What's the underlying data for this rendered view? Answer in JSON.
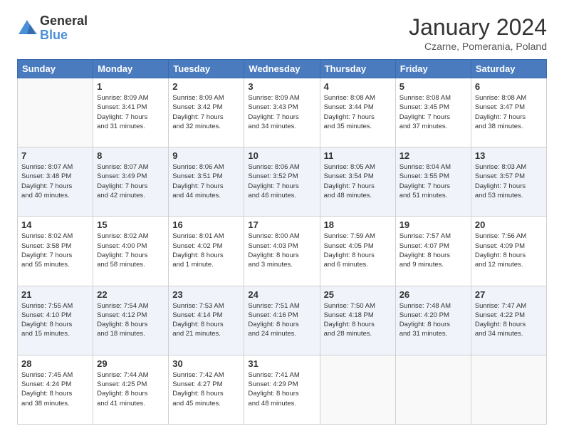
{
  "header": {
    "logo_general": "General",
    "logo_blue": "Blue",
    "month_title": "January 2024",
    "subtitle": "Czarne, Pomerania, Poland"
  },
  "weekdays": [
    "Sunday",
    "Monday",
    "Tuesday",
    "Wednesday",
    "Thursday",
    "Friday",
    "Saturday"
  ],
  "weeks": [
    [
      {
        "day": "",
        "info": ""
      },
      {
        "day": "1",
        "info": "Sunrise: 8:09 AM\nSunset: 3:41 PM\nDaylight: 7 hours\nand 31 minutes."
      },
      {
        "day": "2",
        "info": "Sunrise: 8:09 AM\nSunset: 3:42 PM\nDaylight: 7 hours\nand 32 minutes."
      },
      {
        "day": "3",
        "info": "Sunrise: 8:09 AM\nSunset: 3:43 PM\nDaylight: 7 hours\nand 34 minutes."
      },
      {
        "day": "4",
        "info": "Sunrise: 8:08 AM\nSunset: 3:44 PM\nDaylight: 7 hours\nand 35 minutes."
      },
      {
        "day": "5",
        "info": "Sunrise: 8:08 AM\nSunset: 3:45 PM\nDaylight: 7 hours\nand 37 minutes."
      },
      {
        "day": "6",
        "info": "Sunrise: 8:08 AM\nSunset: 3:47 PM\nDaylight: 7 hours\nand 38 minutes."
      }
    ],
    [
      {
        "day": "7",
        "info": "Sunrise: 8:07 AM\nSunset: 3:48 PM\nDaylight: 7 hours\nand 40 minutes."
      },
      {
        "day": "8",
        "info": "Sunrise: 8:07 AM\nSunset: 3:49 PM\nDaylight: 7 hours\nand 42 minutes."
      },
      {
        "day": "9",
        "info": "Sunrise: 8:06 AM\nSunset: 3:51 PM\nDaylight: 7 hours\nand 44 minutes."
      },
      {
        "day": "10",
        "info": "Sunrise: 8:06 AM\nSunset: 3:52 PM\nDaylight: 7 hours\nand 46 minutes."
      },
      {
        "day": "11",
        "info": "Sunrise: 8:05 AM\nSunset: 3:54 PM\nDaylight: 7 hours\nand 48 minutes."
      },
      {
        "day": "12",
        "info": "Sunrise: 8:04 AM\nSunset: 3:55 PM\nDaylight: 7 hours\nand 51 minutes."
      },
      {
        "day": "13",
        "info": "Sunrise: 8:03 AM\nSunset: 3:57 PM\nDaylight: 7 hours\nand 53 minutes."
      }
    ],
    [
      {
        "day": "14",
        "info": "Sunrise: 8:02 AM\nSunset: 3:58 PM\nDaylight: 7 hours\nand 55 minutes."
      },
      {
        "day": "15",
        "info": "Sunrise: 8:02 AM\nSunset: 4:00 PM\nDaylight: 7 hours\nand 58 minutes."
      },
      {
        "day": "16",
        "info": "Sunrise: 8:01 AM\nSunset: 4:02 PM\nDaylight: 8 hours\nand 1 minute."
      },
      {
        "day": "17",
        "info": "Sunrise: 8:00 AM\nSunset: 4:03 PM\nDaylight: 8 hours\nand 3 minutes."
      },
      {
        "day": "18",
        "info": "Sunrise: 7:59 AM\nSunset: 4:05 PM\nDaylight: 8 hours\nand 6 minutes."
      },
      {
        "day": "19",
        "info": "Sunrise: 7:57 AM\nSunset: 4:07 PM\nDaylight: 8 hours\nand 9 minutes."
      },
      {
        "day": "20",
        "info": "Sunrise: 7:56 AM\nSunset: 4:09 PM\nDaylight: 8 hours\nand 12 minutes."
      }
    ],
    [
      {
        "day": "21",
        "info": "Sunrise: 7:55 AM\nSunset: 4:10 PM\nDaylight: 8 hours\nand 15 minutes."
      },
      {
        "day": "22",
        "info": "Sunrise: 7:54 AM\nSunset: 4:12 PM\nDaylight: 8 hours\nand 18 minutes."
      },
      {
        "day": "23",
        "info": "Sunrise: 7:53 AM\nSunset: 4:14 PM\nDaylight: 8 hours\nand 21 minutes."
      },
      {
        "day": "24",
        "info": "Sunrise: 7:51 AM\nSunset: 4:16 PM\nDaylight: 8 hours\nand 24 minutes."
      },
      {
        "day": "25",
        "info": "Sunrise: 7:50 AM\nSunset: 4:18 PM\nDaylight: 8 hours\nand 28 minutes."
      },
      {
        "day": "26",
        "info": "Sunrise: 7:48 AM\nSunset: 4:20 PM\nDaylight: 8 hours\nand 31 minutes."
      },
      {
        "day": "27",
        "info": "Sunrise: 7:47 AM\nSunset: 4:22 PM\nDaylight: 8 hours\nand 34 minutes."
      }
    ],
    [
      {
        "day": "28",
        "info": "Sunrise: 7:45 AM\nSunset: 4:24 PM\nDaylight: 8 hours\nand 38 minutes."
      },
      {
        "day": "29",
        "info": "Sunrise: 7:44 AM\nSunset: 4:25 PM\nDaylight: 8 hours\nand 41 minutes."
      },
      {
        "day": "30",
        "info": "Sunrise: 7:42 AM\nSunset: 4:27 PM\nDaylight: 8 hours\nand 45 minutes."
      },
      {
        "day": "31",
        "info": "Sunrise: 7:41 AM\nSunset: 4:29 PM\nDaylight: 8 hours\nand 48 minutes."
      },
      {
        "day": "",
        "info": ""
      },
      {
        "day": "",
        "info": ""
      },
      {
        "day": "",
        "info": ""
      }
    ]
  ]
}
